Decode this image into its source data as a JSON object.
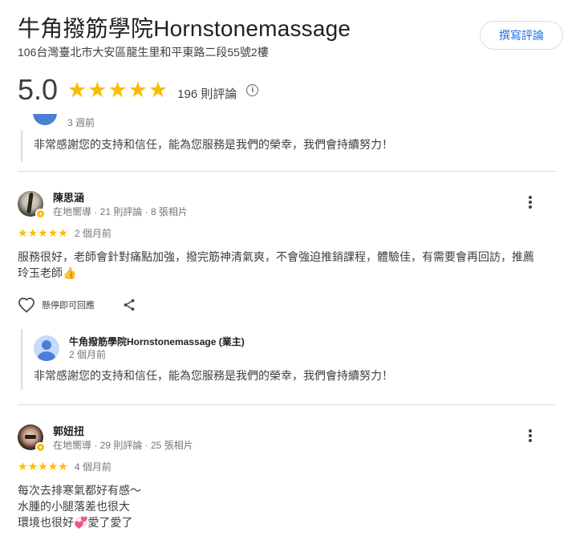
{
  "business": {
    "name": "牛角撥筋學院Hornstonemassage",
    "address": "106台灣臺北市大安區龍生里和平東路二段55號2樓",
    "rating": "5.0",
    "review_count": "196 則評論",
    "write_review_label": "撰寫評論"
  },
  "prev_reply": {
    "time": "3 週前",
    "text": "非常感謝您的支持和信任，能為您服務是我們的榮幸，我們會持續努力！"
  },
  "reviews": [
    {
      "name": "陳思涵",
      "meta": "在地嚮導 · 21 則評論 · 8 張相片",
      "time": "2 個月前",
      "text": "服務很好，老師會針對痛點加強，撥完筋神清氣爽，不會強迫推銷課程，體驗佳，有需要會再回訪，推薦\n玲玉老師👍",
      "like_label": "懸停即可回應",
      "owner_reply": {
        "name": "牛角撥筋學院Hornstonemassage (業主)",
        "time": "2 個月前",
        "text": "非常感謝您的支持和信任，能為您服務是我們的榮幸，我們會持續努力！"
      }
    },
    {
      "name": "郭妞扭",
      "meta": "在地嚮導 · 29 則評論 · 25 張相片",
      "time": "4 個月前",
      "text": "每次去排寒氣都好有感～\n水腫的小腿落差也很大\n環境也很好💞愛了愛了"
    }
  ],
  "colors": {
    "star": "#fbbc04",
    "accent": "#1a73e8",
    "badge": "#fbbc04"
  },
  "icons": [
    "star-icon",
    "info-icon",
    "more-vert-icon",
    "heart-icon",
    "share-icon",
    "local-guide-badge-icon",
    "person-avatar-icon"
  ]
}
